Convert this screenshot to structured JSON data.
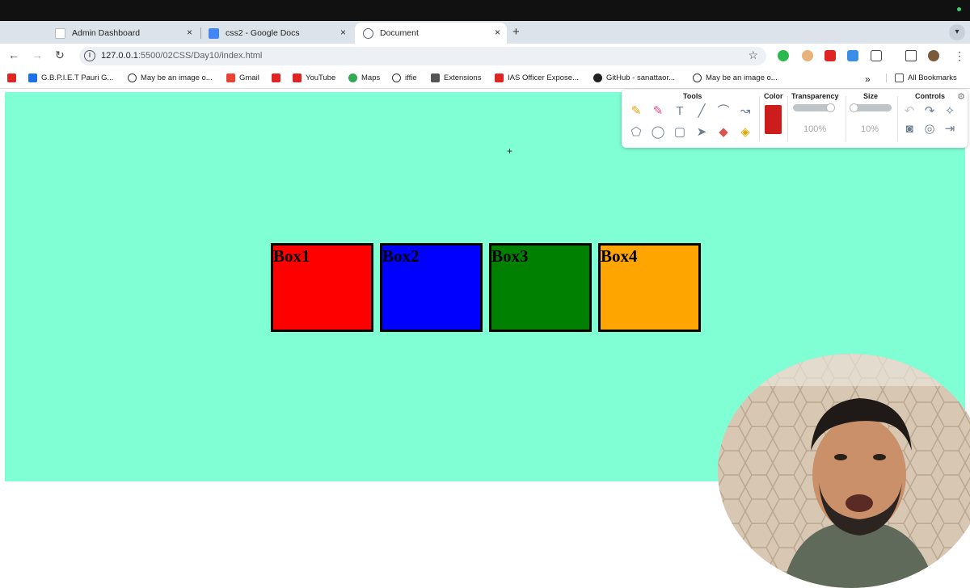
{
  "browser": {
    "tabs": [
      {
        "title": "Admin Dashboard",
        "active": false
      },
      {
        "title": "css2 - Google Docs",
        "active": false
      },
      {
        "title": "Document",
        "active": true
      }
    ],
    "new_tab_label": "+",
    "tab_close_label": "×",
    "url_host": "127.0.0.1",
    "url_path": ":5500/02CSS/Day10/index.html",
    "bookmarks": [
      {
        "label": "",
        "icon": "youtube-icon"
      },
      {
        "label": "G.B.P.I.E.T Pauri G...",
        "icon": "gbpiet-icon"
      },
      {
        "label": "May be an image o...",
        "icon": "globe-icon"
      },
      {
        "label": "Gmail",
        "icon": "gmail-icon"
      },
      {
        "label": "",
        "icon": "youtube-icon"
      },
      {
        "label": "YouTube",
        "icon": "youtube-icon"
      },
      {
        "label": "Maps",
        "icon": "maps-icon"
      },
      {
        "label": "iffie",
        "icon": "globe-icon"
      },
      {
        "label": "Extensions",
        "icon": "puzzle-icon"
      },
      {
        "label": "IAS Officer Expose...",
        "icon": "youtube-icon"
      },
      {
        "label": "GitHub - sanattaor...",
        "icon": "github-icon"
      },
      {
        "label": "May be an image o...",
        "icon": "globe-icon"
      }
    ],
    "overflow_label": "»",
    "all_bookmarks_label": "All Bookmarks"
  },
  "page": {
    "background": "#80ffd4",
    "boxes": [
      {
        "label": "Box1",
        "color": "#ff0000"
      },
      {
        "label": "Box2",
        "color": "#0000ff"
      },
      {
        "label": "Box3",
        "color": "#008000"
      },
      {
        "label": "Box4",
        "color": "#ffa500"
      }
    ]
  },
  "annotation_toolbar": {
    "tools_header": "Tools",
    "color_header": "Color",
    "transparency_header": "Transparency",
    "size_header": "Size",
    "controls_header": "Controls",
    "transparency_value": "100%",
    "size_value": "10%",
    "selected_color": "#cc1c1c"
  }
}
